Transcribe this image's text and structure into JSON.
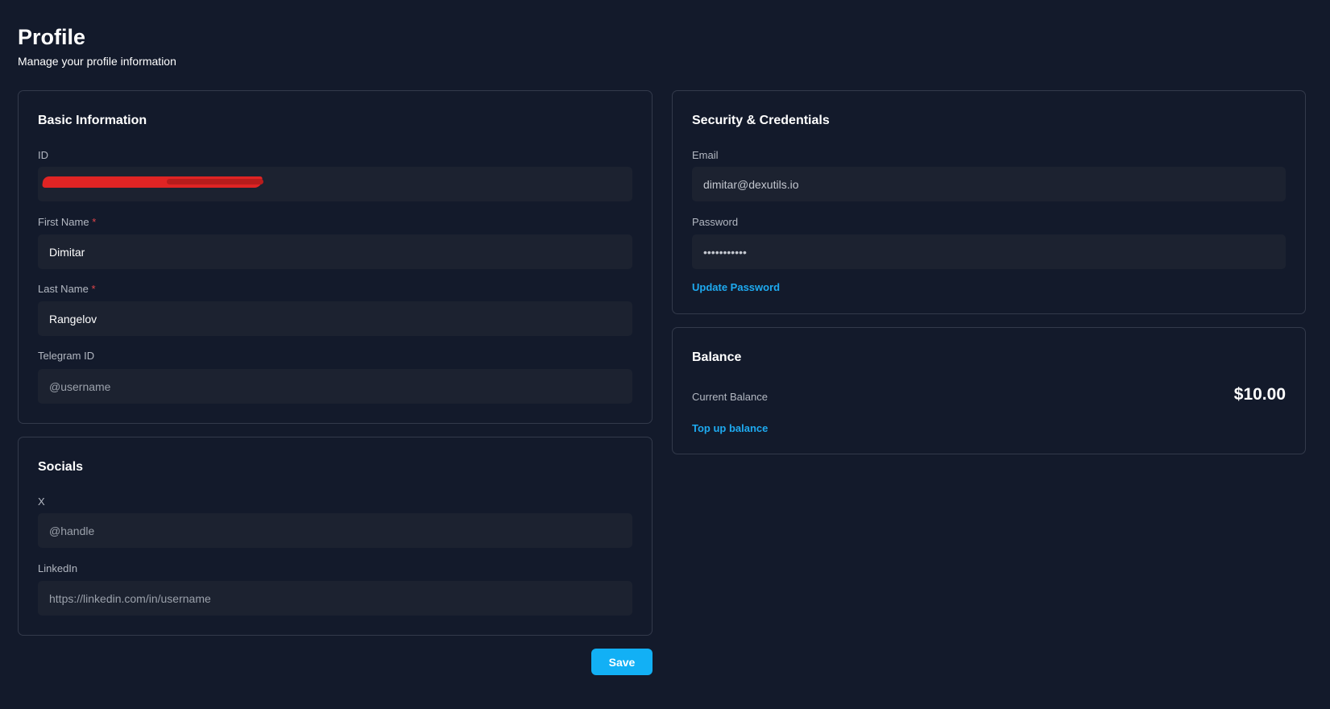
{
  "page": {
    "title": "Profile",
    "subtitle": "Manage your profile information"
  },
  "basic_info": {
    "title": "Basic Information",
    "id_label": "ID",
    "id_value": "",
    "first_name_label": "First Name",
    "first_name_value": "Dimitar",
    "last_name_label": "Last Name",
    "last_name_value": "Rangelov",
    "required_marker": "*",
    "telegram_label": "Telegram ID",
    "telegram_placeholder": "@username"
  },
  "socials": {
    "title": "Socials",
    "x_label": "X",
    "x_placeholder": "@handle",
    "linkedin_label": "LinkedIn",
    "linkedin_placeholder": "https://linkedin.com/in/username"
  },
  "security": {
    "title": "Security & Credentials",
    "email_label": "Email",
    "email_value": "dimitar@dexutils.io",
    "password_label": "Password",
    "password_value": "•••••••••••",
    "update_password_label": "Update Password"
  },
  "balance": {
    "title": "Balance",
    "current_label": "Current Balance",
    "amount": "$10.00",
    "top_up_label": "Top up balance"
  },
  "actions": {
    "save_label": "Save"
  },
  "colors": {
    "background": "#131a2b",
    "field": "#1c2230",
    "accent": "#12b0f5",
    "link": "#1eaaf0",
    "required": "#e0454a"
  }
}
